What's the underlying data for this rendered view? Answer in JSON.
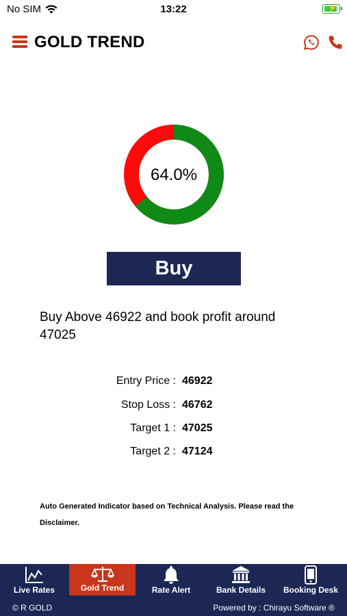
{
  "status_bar": {
    "carrier": "No SIM",
    "time": "13:22",
    "battery_icon": "battery-charging-icon",
    "wifi_icon": "wifi-icon"
  },
  "header": {
    "title": "GOLD TREND",
    "menu_icon": "hamburger-menu-icon",
    "whatsapp_icon": "whatsapp-icon",
    "phone_icon": "phone-icon",
    "accent_color": "#c8361c"
  },
  "gauge": {
    "percent_label": "64.0%",
    "value": 0.64,
    "positive_color": "#0f8a17",
    "negative_color": "#ff0a0a"
  },
  "signal": {
    "label": "Buy",
    "color": "#1c2754"
  },
  "message": "Buy Above 46922 and book profit around 47025",
  "levels": [
    {
      "label": "Entry Price :",
      "value": "46922"
    },
    {
      "label": "Stop Loss :",
      "value": "46762"
    },
    {
      "label": "Target 1 :",
      "value": "47025"
    },
    {
      "label": "Target 2 :",
      "value": "47124"
    }
  ],
  "disclaimer": "Auto Generated Indicator based on Technical Analysis. Please read the Disclaimer.",
  "nav": [
    {
      "label": "Live Rates",
      "icon": "line-chart-icon",
      "active": false
    },
    {
      "label": "Gold Trend",
      "icon": "scales-icon",
      "active": true
    },
    {
      "label": "Rate Alert",
      "icon": "bell-icon",
      "active": false
    },
    {
      "label": "Bank Details",
      "icon": "bank-icon",
      "active": false
    },
    {
      "label": "Booking Desk",
      "icon": "mobile-phone-icon",
      "active": false
    }
  ],
  "footer": {
    "left": "© R GOLD",
    "right": "Powered by : Chirayu Software ®"
  }
}
